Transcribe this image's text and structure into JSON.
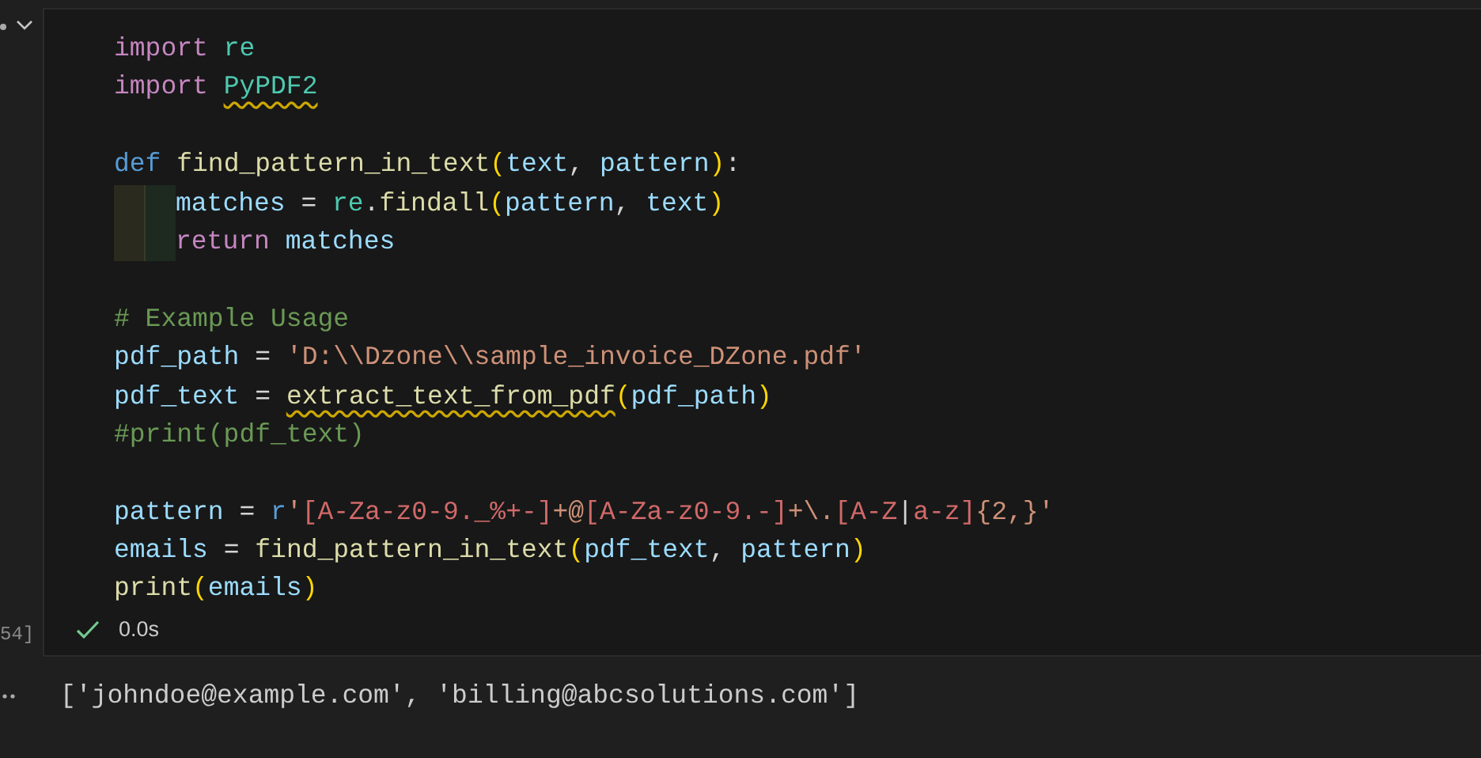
{
  "cell": {
    "execution_count": "54]",
    "code_lines": [
      {
        "kind": "code",
        "tokens": [
          {
            "kind": "keyword",
            "text": "import "
          },
          {
            "kind": "module",
            "text": "re"
          }
        ]
      },
      {
        "kind": "code",
        "tokens": [
          {
            "kind": "keyword",
            "text": "import "
          },
          {
            "kind": "module",
            "text": "PyPDF2",
            "warning": true
          }
        ]
      },
      {
        "kind": "blank"
      },
      {
        "kind": "code",
        "tokens": [
          {
            "kind": "def",
            "text": "def "
          },
          {
            "kind": "func",
            "text": "find_pattern_in_text"
          },
          {
            "kind": "paren",
            "text": "("
          },
          {
            "kind": "var",
            "text": "text"
          },
          {
            "kind": "plain",
            "text": ", "
          },
          {
            "kind": "var",
            "text": "pattern"
          },
          {
            "kind": "paren",
            "text": ")"
          },
          {
            "kind": "plain",
            "text": ":"
          }
        ],
        "children": [
          {
            "kind": "code",
            "tokens": [
              {
                "kind": "var",
                "text": "matches"
              },
              {
                "kind": "plain",
                "text": " = "
              },
              {
                "kind": "module",
                "text": "re"
              },
              {
                "kind": "plain",
                "text": "."
              },
              {
                "kind": "func",
                "text": "findall"
              },
              {
                "kind": "paren",
                "text": "("
              },
              {
                "kind": "var",
                "text": "pattern"
              },
              {
                "kind": "plain",
                "text": ", "
              },
              {
                "kind": "var",
                "text": "text"
              },
              {
                "kind": "paren",
                "text": ")"
              }
            ]
          },
          {
            "kind": "code",
            "tokens": [
              {
                "kind": "keyword",
                "text": "return "
              },
              {
                "kind": "var",
                "text": "matches"
              }
            ]
          }
        ]
      },
      {
        "kind": "blank"
      },
      {
        "kind": "code",
        "tokens": [
          {
            "kind": "comment",
            "text": "# Example Usage"
          }
        ]
      },
      {
        "kind": "code",
        "tokens": [
          {
            "kind": "var",
            "text": "pdf_path"
          },
          {
            "kind": "plain",
            "text": " = "
          },
          {
            "kind": "string",
            "text": "'D:\\\\Dzone\\\\sample_invoice_DZone.pdf'"
          }
        ]
      },
      {
        "kind": "code",
        "tokens": [
          {
            "kind": "var",
            "text": "pdf_text"
          },
          {
            "kind": "plain",
            "text": " = "
          },
          {
            "kind": "func",
            "text": "extract_text_from_pdf",
            "warning": true
          },
          {
            "kind": "paren",
            "text": "("
          },
          {
            "kind": "var",
            "text": "pdf_path"
          },
          {
            "kind": "paren",
            "text": ")"
          }
        ]
      },
      {
        "kind": "code",
        "tokens": [
          {
            "kind": "comment",
            "text": "#print(pdf_text)"
          }
        ]
      },
      {
        "kind": "blank"
      },
      {
        "kind": "code",
        "tokens": [
          {
            "kind": "var",
            "text": "pattern"
          },
          {
            "kind": "plain",
            "text": " = "
          },
          {
            "kind": "def",
            "text": "r"
          },
          {
            "kind": "string",
            "text": "'"
          },
          {
            "kind": "regex",
            "text": "[A-Za-z0-9._%+-]"
          },
          {
            "kind": "string",
            "text": "+@"
          },
          {
            "kind": "regex",
            "text": "[A-Za-z0-9.-]"
          },
          {
            "kind": "string",
            "text": "+\\."
          },
          {
            "kind": "regex",
            "text": "[A-Z"
          },
          {
            "kind": "plain",
            "text": "|"
          },
          {
            "kind": "regex",
            "text": "a-z]"
          },
          {
            "kind": "string",
            "text": "{2,}'"
          }
        ]
      },
      {
        "kind": "code",
        "tokens": [
          {
            "kind": "var",
            "text": "emails"
          },
          {
            "kind": "plain",
            "text": " = "
          },
          {
            "kind": "func",
            "text": "find_pattern_in_text"
          },
          {
            "kind": "paren",
            "text": "("
          },
          {
            "kind": "var",
            "text": "pdf_text"
          },
          {
            "kind": "plain",
            "text": ", "
          },
          {
            "kind": "var",
            "text": "pattern"
          },
          {
            "kind": "paren",
            "text": ")"
          }
        ]
      },
      {
        "kind": "code",
        "tokens": [
          {
            "kind": "func",
            "text": "print"
          },
          {
            "kind": "paren",
            "text": "("
          },
          {
            "kind": "var",
            "text": "emails"
          },
          {
            "kind": "paren",
            "text": ")"
          }
        ]
      }
    ],
    "status": {
      "success": true,
      "duration": "0.0s"
    }
  },
  "output": {
    "text": "['johndoe@example.com', 'billing@abcsolutions.com']"
  }
}
